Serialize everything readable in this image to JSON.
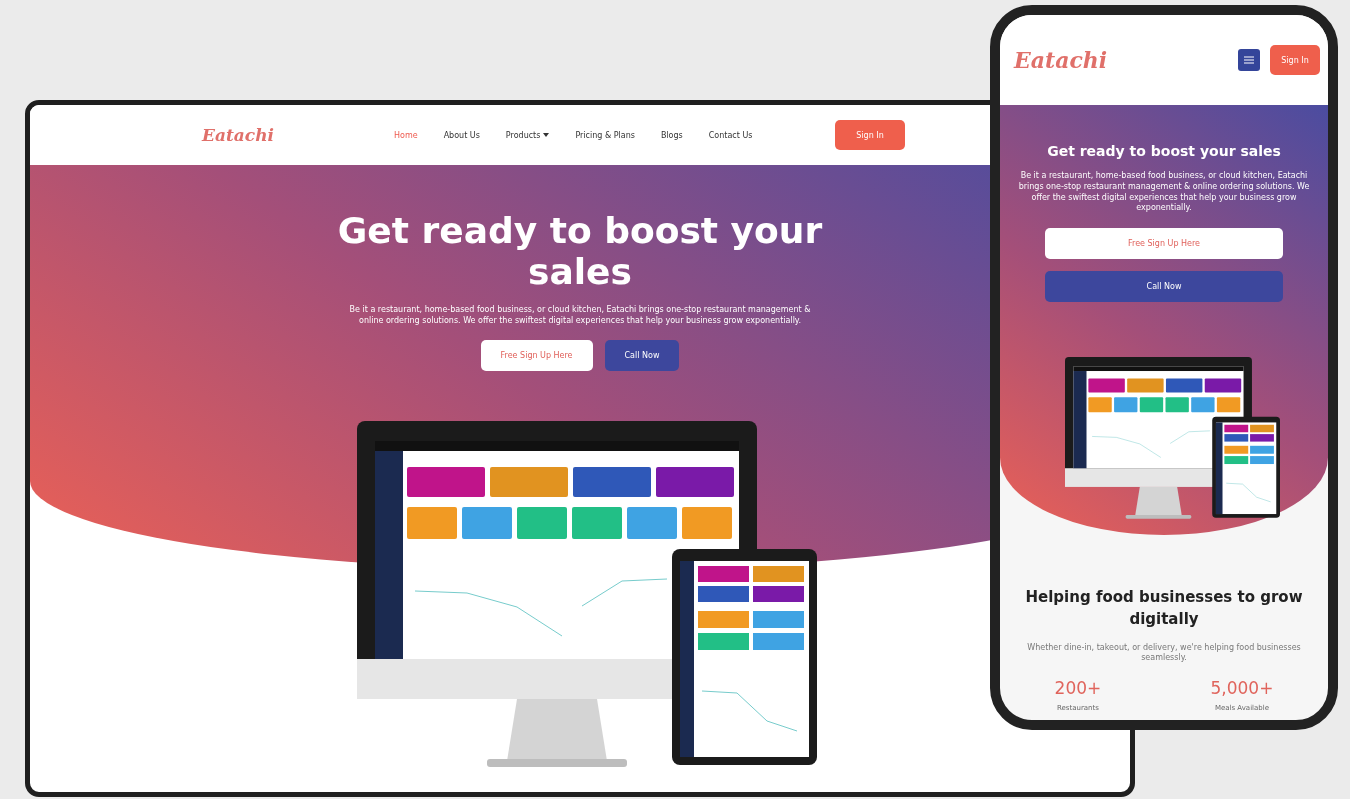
{
  "desktop": {
    "logo": "Eatachi",
    "nav": [
      {
        "label": "Home",
        "selected": true
      },
      {
        "label": "About Us",
        "selected": false
      },
      {
        "label": "Products",
        "selected": false,
        "dropdown": true
      },
      {
        "label": "Pricing & Plans",
        "selected": false
      },
      {
        "label": "Blogs",
        "selected": false
      },
      {
        "label": "Contact Us",
        "selected": false
      }
    ],
    "sign_in": "Sign In",
    "hero": {
      "title": "Get ready to boost your sales",
      "text": "Be it a restaurant, home-based food business, or cloud kitchen, Eatachi brings one-stop restaurant management & online ordering solutions. We offer the swiftest digital experiences that help your business grow exponentially.",
      "buttons": [
        {
          "label": "Free Sign Up Here",
          "kind": "light"
        },
        {
          "label": "Call Now",
          "kind": "dark"
        }
      ]
    }
  },
  "mobile": {
    "logo": "Eatachi",
    "sign_in": "Sign In",
    "hero": {
      "title": "Get ready to boost your sales",
      "text": "Be it a restaurant, home-based food business, or cloud kitchen, Eatachi brings one-stop restaurant management & online ordering solutions. We offer the swiftest digital experiences that help your business grow exponentially.",
      "buttons": [
        {
          "label": "Free Sign Up Here",
          "kind": "light"
        },
        {
          "label": "Call Now",
          "kind": "dark"
        }
      ]
    },
    "section": {
      "title": "Helping food businesses to grow digitally",
      "text": "Whether dine-in, takeout, or delivery, we're helping food businesses seamlessly.",
      "stats": [
        {
          "value": "200+",
          "label": "Restaurants"
        },
        {
          "value": "5,000+",
          "label": "Meals Available"
        }
      ]
    }
  }
}
